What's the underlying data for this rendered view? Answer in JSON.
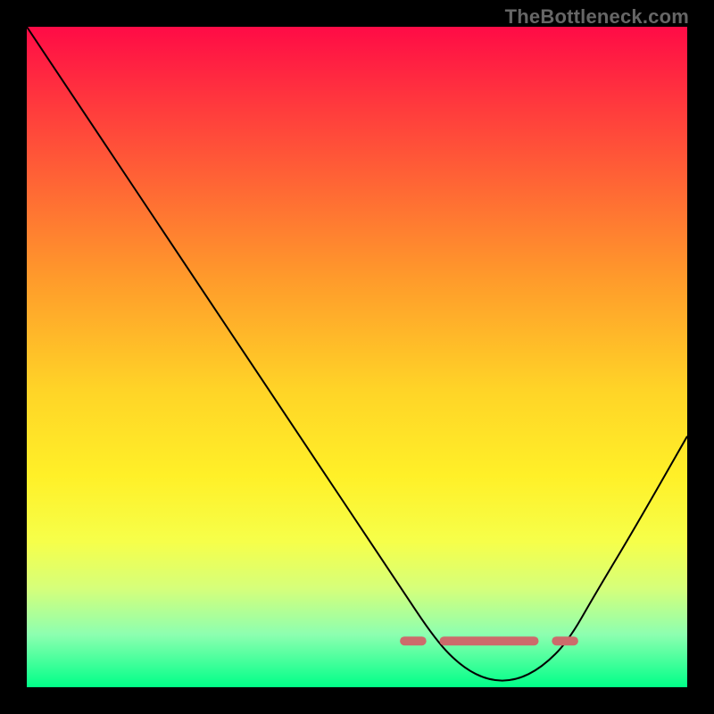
{
  "watermark": "TheBottleneck.com",
  "chart_data": {
    "type": "line",
    "title": "",
    "xlabel": "",
    "ylabel": "",
    "xlim": [
      0,
      100
    ],
    "ylim": [
      0,
      100
    ],
    "x": [
      0,
      8,
      16,
      24,
      32,
      40,
      48,
      56,
      62,
      66,
      70,
      74,
      78,
      82,
      86,
      92,
      100
    ],
    "values": [
      100,
      88,
      76,
      64,
      52,
      40,
      28,
      16,
      7,
      3,
      1,
      1,
      3,
      7,
      14,
      24,
      38
    ],
    "bump_band": {
      "y_frac": 0.07,
      "segments": [
        {
          "x0_frac": 0.565,
          "x1_frac": 0.605
        },
        {
          "x0_frac": 0.625,
          "x1_frac": 0.775
        },
        {
          "x0_frac": 0.795,
          "x1_frac": 0.835
        }
      ],
      "color": "#cc6b6b"
    },
    "curve_color": "#000000",
    "curve_width": 2
  }
}
